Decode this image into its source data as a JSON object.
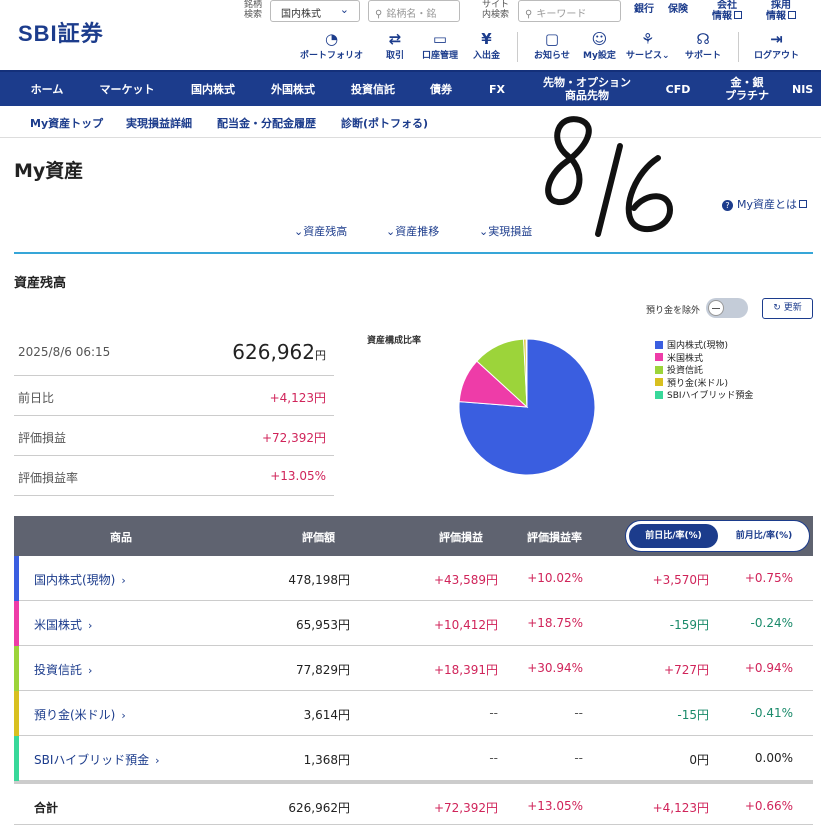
{
  "header": {
    "logo": "SBI証券",
    "stock_search_label_1": "銘柄",
    "stock_search_label_2": "検索",
    "market_select": "国内株式",
    "stock_search_placeholder": "銘柄名・銘",
    "site_search_label_1": "サイト",
    "site_search_label_2": "内検索",
    "site_search_placeholder": "キーワード",
    "links": [
      {
        "line1": "銀行",
        "line2": ""
      },
      {
        "line1": "保険",
        "line2": ""
      },
      {
        "line1": "会社",
        "line2": "情報"
      },
      {
        "line1": "採用",
        "line2": "情報"
      }
    ],
    "icon_buttons": [
      {
        "label": "ポートフォリオ",
        "icon": "portfolio-icon"
      },
      {
        "label": "取引",
        "icon": "trade-icon"
      },
      {
        "label": "口座管理",
        "icon": "account-icon"
      },
      {
        "label": "入出金",
        "icon": "yen-icon"
      },
      {
        "label": "お知らせ",
        "icon": "message-icon"
      },
      {
        "label": "My設定",
        "icon": "user-icon"
      },
      {
        "label": "サービス",
        "icon": "service-icon"
      },
      {
        "label": "サポート",
        "icon": "headset-icon"
      },
      {
        "label": "ログアウト",
        "icon": "logout-icon"
      }
    ]
  },
  "nav": [
    "ホーム",
    "マーケット",
    "国内株式",
    "外国株式",
    "投資信託",
    "債券",
    "FX",
    "先物・オプション",
    "商品先物",
    "CFD",
    "金・銀",
    "プラチナ",
    "NIS"
  ],
  "subnav": [
    "My資産トップ",
    "実現損益詳細",
    "配当金・分配金履歴",
    "診断(ポトフォる)"
  ],
  "handwriting": "8/6",
  "page_title": "My資産",
  "help_link": "My資産とは",
  "anchors": [
    "資産残高",
    "資産推移",
    "実現損益"
  ],
  "section_title": "資産残高",
  "toggle_label": "預り金を除外",
  "refresh_label": "更新",
  "summary": {
    "datetime": "2025/8/6 06:15",
    "total": "626,962",
    "yen": "円",
    "rows": [
      {
        "label": "前日比",
        "value": "+4,123円"
      },
      {
        "label": "評価損益",
        "value": "+72,392円"
      },
      {
        "label": "評価損益率",
        "value": "+13.05%"
      }
    ]
  },
  "chart_data": {
    "type": "pie",
    "title": "資産構成比率",
    "labels": [
      "国内株式(現物)",
      "米国株式",
      "投資信託",
      "預り金(米ドル)",
      "SBIハイブリッド預金"
    ],
    "values": [
      478198,
      65953,
      77829,
      3614,
      1368
    ],
    "colors": [
      "#3a5ee0",
      "#ee3ca8",
      "#9cd43a",
      "#d8c020",
      "#38d89a"
    ],
    "legend_position": "right"
  },
  "table": {
    "headers": [
      "商品",
      "評価額",
      "評価損益",
      "評価損益率"
    ],
    "seg_active": "前日比/率(%)",
    "seg_inactive": "前月比/率(%)",
    "rows": [
      {
        "name": "国内株式(現物)",
        "value": "478,198円",
        "pl": "+43,589円",
        "plr": "+10.02%",
        "day": "+3,570円",
        "dayr": "+0.75%",
        "color": "#3a5ee0",
        "day_tone": "pos"
      },
      {
        "name": "米国株式",
        "value": "65,953円",
        "pl": "+10,412円",
        "plr": "+18.75%",
        "day": "-159円",
        "dayr": "-0.24%",
        "color": "#ee3ca8",
        "day_tone": "neg"
      },
      {
        "name": "投資信託",
        "value": "77,829円",
        "pl": "+18,391円",
        "plr": "+30.94%",
        "day": "+727円",
        "dayr": "+0.94%",
        "color": "#9cd43a",
        "day_tone": "pos"
      },
      {
        "name": "預り金(米ドル)",
        "value": "3,614円",
        "pl": "--",
        "plr": "--",
        "day": "-15円",
        "dayr": "-0.41%",
        "color": "#d8c020",
        "day_tone": "neg"
      },
      {
        "name": "SBIハイブリッド預金",
        "value": "1,368円",
        "pl": "--",
        "plr": "--",
        "day": "0円",
        "dayr": "0.00%",
        "color": "#38d89a",
        "day_tone": "neu"
      }
    ],
    "total": {
      "name": "合計",
      "value": "626,962円",
      "pl": "+72,392円",
      "plr": "+13.05%",
      "day": "+4,123円",
      "dayr": "+0.66%"
    }
  }
}
